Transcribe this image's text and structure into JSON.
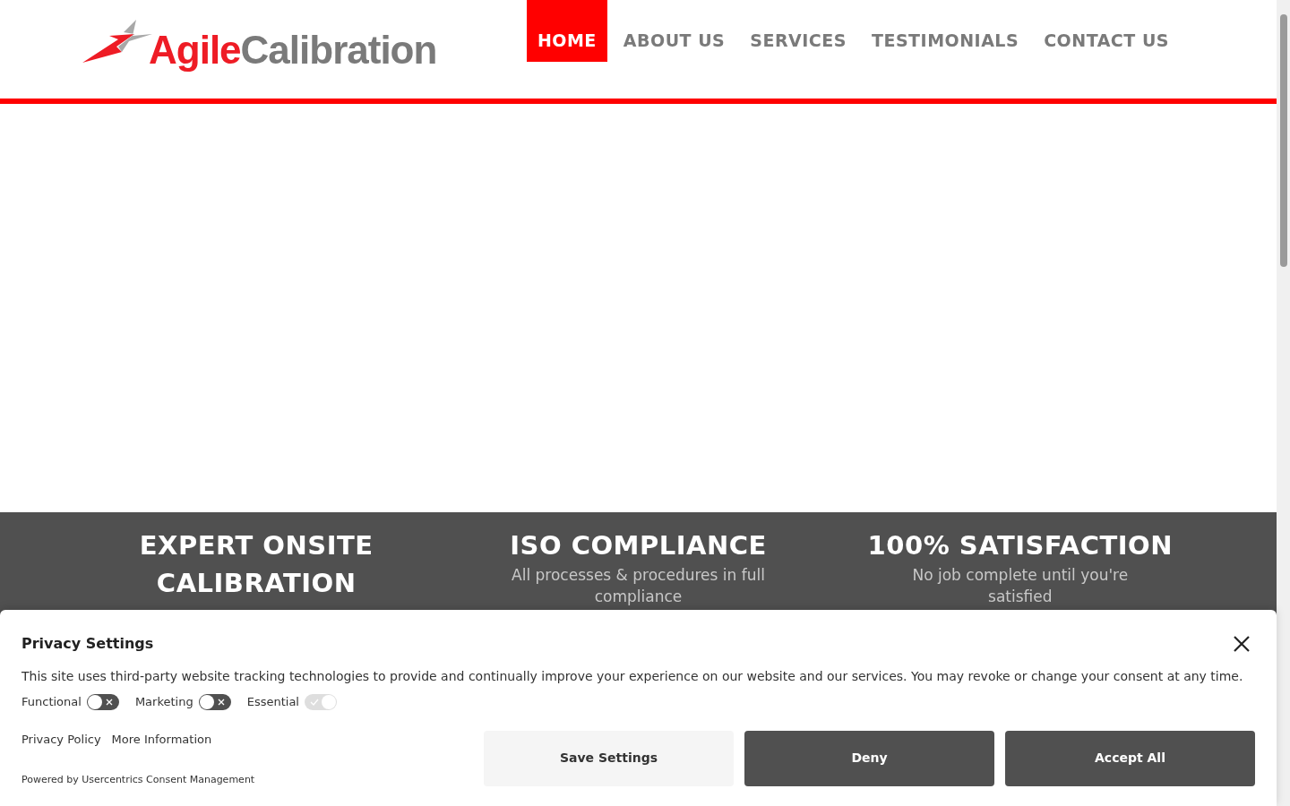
{
  "logo": {
    "first": "Agile",
    "second": "Calibration"
  },
  "nav": [
    {
      "label": "HOME",
      "selected": true
    },
    {
      "label": "ABOUT US",
      "selected": false
    },
    {
      "label": "SERVICES",
      "selected": false
    },
    {
      "label": "TESTIMONIALS",
      "selected": false
    },
    {
      "label": "CONTACT US",
      "selected": false
    }
  ],
  "features": [
    {
      "title": "EXPERT ONSITE CALIBRATION"
    },
    {
      "title": "ISO COMPLIANCE",
      "text": "All processes & procedures in full compliance"
    },
    {
      "title": "100% SATISFACTION",
      "text": "No job complete until you're satisfied"
    }
  ],
  "consent": {
    "title": "Privacy Settings",
    "text": "This site uses third-party website tracking technologies to provide and continually improve your experience on our website and our services. You may revoke or change your consent at any time.",
    "toggles": [
      {
        "label": "Functional",
        "on": false,
        "disabled": false
      },
      {
        "label": "Marketing",
        "on": false,
        "disabled": false
      },
      {
        "label": "Essential",
        "on": true,
        "disabled": true
      }
    ],
    "links": [
      "Privacy Policy",
      "More Information"
    ],
    "powered_by": "Powered by Usercentrics Consent Management",
    "buttons": [
      {
        "label": "Save Settings",
        "kind": "light"
      },
      {
        "label": "Deny",
        "kind": "dark"
      },
      {
        "label": "Accept All",
        "kind": "dark"
      }
    ]
  }
}
